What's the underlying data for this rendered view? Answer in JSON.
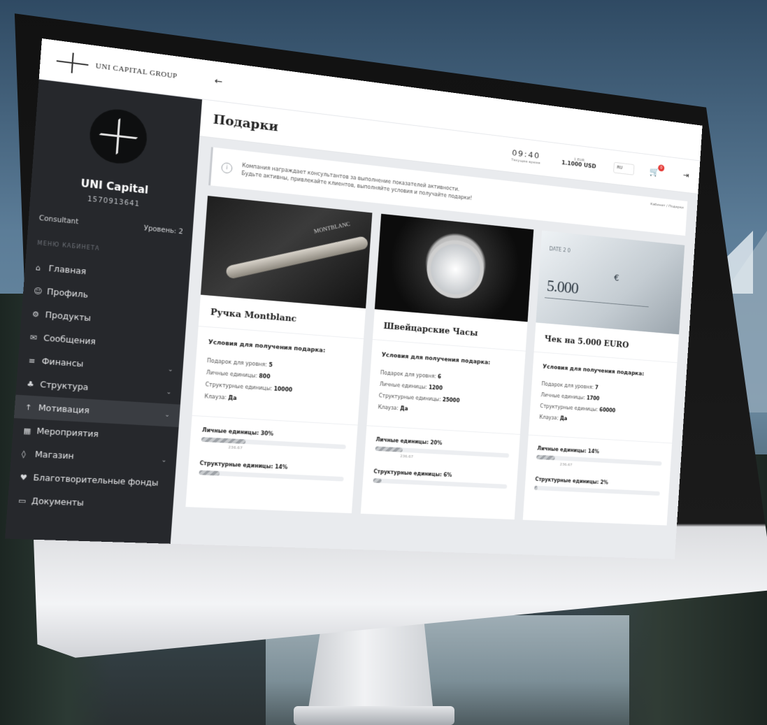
{
  "brand": {
    "name": "UNI CAPITAL GROUP"
  },
  "sidebar": {
    "user_name": "UNI Capital",
    "user_id": "1570913641",
    "role": "Consultant",
    "level": "Уровень: 2",
    "menu_caption": "МЕНЮ КАБИНЕТА",
    "items": [
      {
        "label": "Главная",
        "icon": "home-icon",
        "glyph": "⌂"
      },
      {
        "label": "Профиль",
        "icon": "profile-icon",
        "glyph": "☺"
      },
      {
        "label": "Продукты",
        "icon": "products-icon",
        "glyph": "⚙"
      },
      {
        "label": "Сообщения",
        "icon": "messages-icon",
        "glyph": "✉"
      },
      {
        "label": "Финансы",
        "icon": "finance-icon",
        "glyph": "≡"
      },
      {
        "label": "Структура",
        "icon": "structure-icon",
        "glyph": "♣"
      },
      {
        "label": "Мотивация",
        "icon": "motivation-icon",
        "glyph": "↑"
      },
      {
        "label": "Мероприятия",
        "icon": "events-icon",
        "glyph": "▦"
      },
      {
        "label": "Магазин",
        "icon": "shop-icon",
        "glyph": "◊"
      },
      {
        "label": "Благотворительные фонды",
        "icon": "charity-icon",
        "glyph": "♥"
      },
      {
        "label": "Документы",
        "icon": "documents-icon",
        "glyph": "▭"
      }
    ]
  },
  "header": {
    "title": "Подарки",
    "clock": "09:40",
    "clock_sub": "Текущее время",
    "rate_top": "1 EUR",
    "rate_value": "1.1000 USD",
    "lang": "RU",
    "cart_count": "0"
  },
  "notice": {
    "line1": "Компания награждает консультантов за выполнение показателей активности.",
    "line2": "Будьте активны, привлекайте клиентов, выполняйте условия и получайте подарки!",
    "breadcrumb": "Кабинет / Подарки"
  },
  "gifts": [
    {
      "title": "Ручка Montblanc",
      "image": "pen",
      "conditions_title": "Условия для получения подарка:",
      "level_label": "Подарок для уровня:",
      "level": "5",
      "personal_label": "Личные единицы:",
      "personal": "800",
      "structural_label": "Структурные единицы:",
      "structural": "10000",
      "clause_label": "Клауза:",
      "clause": "Да",
      "progress": [
        {
          "label": "Личные единицы: 30%",
          "note": "236.67",
          "fraction": 0.3
        },
        {
          "label": "Структурные единицы: 14%",
          "note": "",
          "fraction": 0.14
        }
      ]
    },
    {
      "title": "Швейцарские Часы",
      "image": "watch",
      "conditions_title": "Условия для получения подарка:",
      "level_label": "Подарок для уровня:",
      "level": "6",
      "personal_label": "Личные единицы:",
      "personal": "1200",
      "structural_label": "Структурные единицы:",
      "structural": "25000",
      "clause_label": "Клауза:",
      "clause": "Да",
      "progress": [
        {
          "label": "Личные единицы: 20%",
          "note": "236.67",
          "fraction": 0.2
        },
        {
          "label": "Структурные единицы: 6%",
          "note": "",
          "fraction": 0.06
        }
      ]
    },
    {
      "title": "Чек на 5.000 EURO",
      "image": "cheque",
      "cheque_amount": "5.000",
      "cheque_currency": "€",
      "cheque_date": "DATE 2 0",
      "conditions_title": "Условия для получения подарка:",
      "level_label": "Подарок для уровня:",
      "level": "7",
      "personal_label": "Личные единицы:",
      "personal": "1700",
      "structural_label": "Структурные единицы:",
      "structural": "60000",
      "clause_label": "Клауза:",
      "clause": "Да",
      "progress": [
        {
          "label": "Личные единицы: 14%",
          "note": "236.67",
          "fraction": 0.14
        },
        {
          "label": "Структурные единицы: 2%",
          "note": "",
          "fraction": 0.02
        }
      ]
    }
  ],
  "colors": {
    "sidebar": "#26282c",
    "accent_red": "#e53935",
    "page_bg": "#e9ebee"
  }
}
